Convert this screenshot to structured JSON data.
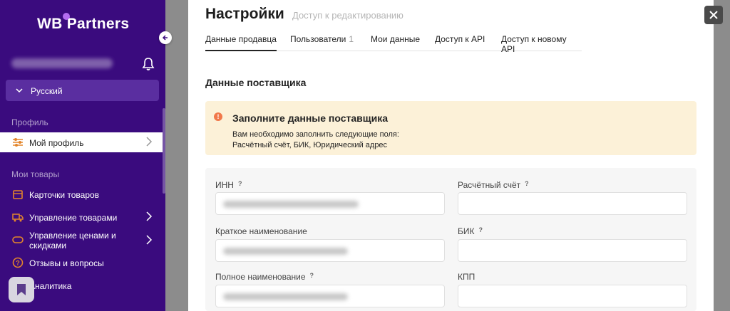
{
  "sidebar": {
    "logo": "WB Partners",
    "language": "Русский",
    "sections": {
      "profile": "Профиль",
      "goods": "Мои товары"
    },
    "items": [
      {
        "label": "Мой профиль",
        "icon": "sliders-icon"
      },
      {
        "label": "Карточки товаров",
        "icon": "box-icon"
      },
      {
        "label": "Управление товарами",
        "icon": "truck-icon"
      },
      {
        "label": "Управление ценами и скидками",
        "icon": "tag-icon"
      },
      {
        "label": "Отзывы и вопросы",
        "icon": "question-icon"
      },
      {
        "label": "Аналитика",
        "icon": "chart-icon"
      }
    ]
  },
  "header": {
    "title": "Настройки",
    "subtitle": "Доступ к редактированию"
  },
  "tabs": [
    {
      "label": "Данные продавца"
    },
    {
      "label": "Пользователи",
      "count": "1"
    },
    {
      "label": "Мои данные"
    },
    {
      "label": "Доступ к API"
    },
    {
      "label": "Доступ к новому API"
    }
  ],
  "section_title": "Данные поставщика",
  "alert": {
    "title": "Заполните данные поставщика",
    "line1": "Вам необходимо заполнить следующие поля:",
    "line2": "Расчётный счёт, БИК, Юридический адрес"
  },
  "form": {
    "inn": "ИНН",
    "account": "Расчётный счёт",
    "short_name": "Краткое наименование",
    "bik": "БИК",
    "full_name": "Полное наименование",
    "kpp": "КПП",
    "help_mark": "?"
  },
  "colors": {
    "sidebar_bg": "#3a0b7e",
    "alert_bg": "#fcf1d8",
    "alert_icon": "#f1784a",
    "logo_dot": "#b36cf0"
  }
}
